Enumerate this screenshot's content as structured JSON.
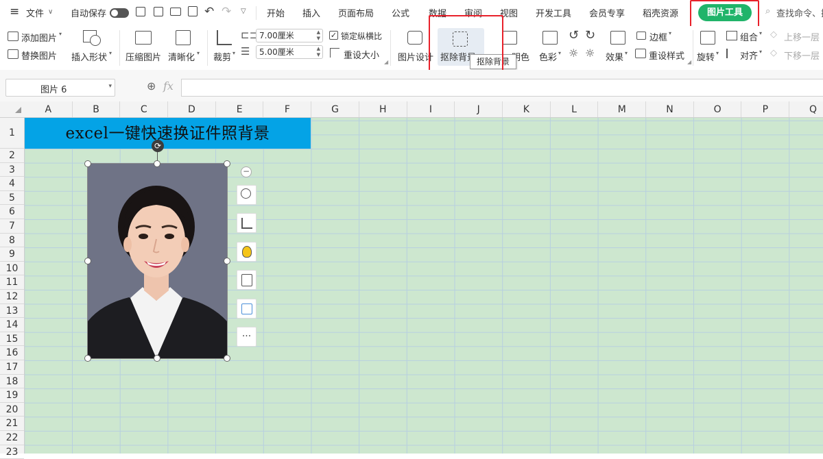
{
  "menu": {
    "hamburger": "≡",
    "file": "文件",
    "autosave": "自动保存",
    "tabs": [
      "开始",
      "插入",
      "页面布局",
      "公式",
      "数据",
      "审阅",
      "视图",
      "开发工具",
      "会员专享",
      "稻壳资源"
    ],
    "active_tab": "图片工具",
    "search_placeholder": "查找命令、搜"
  },
  "ribbon": {
    "add_picture": "添加图片",
    "replace_picture": "替换图片",
    "insert_shape": "插入形状",
    "compress_picture": "压缩图片",
    "sharpen": "清晰化",
    "crop": "裁剪",
    "width_value": "7.00厘米",
    "height_value": "5.00厘米",
    "lock_ratio": "锁定纵横比",
    "reset_size": "重设大小",
    "picture_design": "图片设计",
    "remove_background": "抠除背景",
    "transparency": "明色",
    "color": "色彩",
    "border": "边框",
    "effects": "效果",
    "reset_style": "重设样式",
    "rotate": "旋转",
    "group": "组合",
    "align": "对齐",
    "bring_forward": "上移一层",
    "send_backward": "下移一层",
    "tooltip": "抠除背景"
  },
  "formula_bar": {
    "name_box": "图片 6",
    "fx": "fx",
    "formula": ""
  },
  "sheet": {
    "columns": [
      "A",
      "B",
      "C",
      "D",
      "E",
      "F",
      "G",
      "H",
      "I",
      "J",
      "K",
      "L",
      "M",
      "N",
      "O",
      "P",
      "Q"
    ],
    "rows": [
      "1",
      "2",
      "3",
      "4",
      "5",
      "6",
      "7",
      "8",
      "9",
      "10",
      "11",
      "12",
      "13",
      "14",
      "15",
      "16",
      "17",
      "18",
      "19",
      "20",
      "21",
      "22",
      "23"
    ],
    "title": "excel一键快速换证件照背景"
  },
  "colors": {
    "accent_green": "#20b46a",
    "title_fill": "#04a3e6",
    "sheet_fill": "#cde7cf",
    "highlight": "#e8202a"
  }
}
